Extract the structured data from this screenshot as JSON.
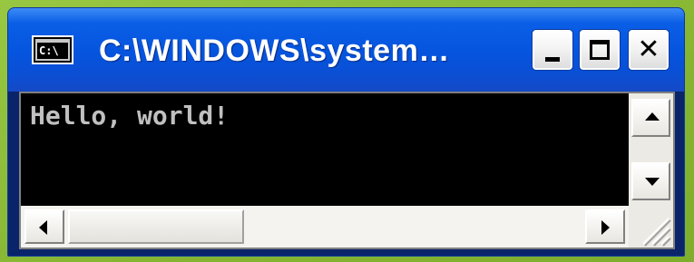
{
  "window": {
    "title": "C:\\WINDOWS\\system…",
    "icon": "console-icon",
    "icon_label": "C:\\"
  },
  "titlebar_buttons": {
    "minimize": "minimize-icon",
    "maximize": "maximize-icon",
    "close": "close-icon",
    "close_glyph": "✕"
  },
  "console": {
    "output": "Hello, world!"
  },
  "scrollbars": {
    "vertical": {
      "up": "arrow-up-icon",
      "down": "arrow-down-icon"
    },
    "horizontal": {
      "left": "arrow-left-icon",
      "right": "arrow-right-icon"
    }
  },
  "colors": {
    "titlebar": "#0654de",
    "console_bg": "#000000",
    "console_text": "#c0c0c0",
    "desktop": "#8dbb3a"
  }
}
